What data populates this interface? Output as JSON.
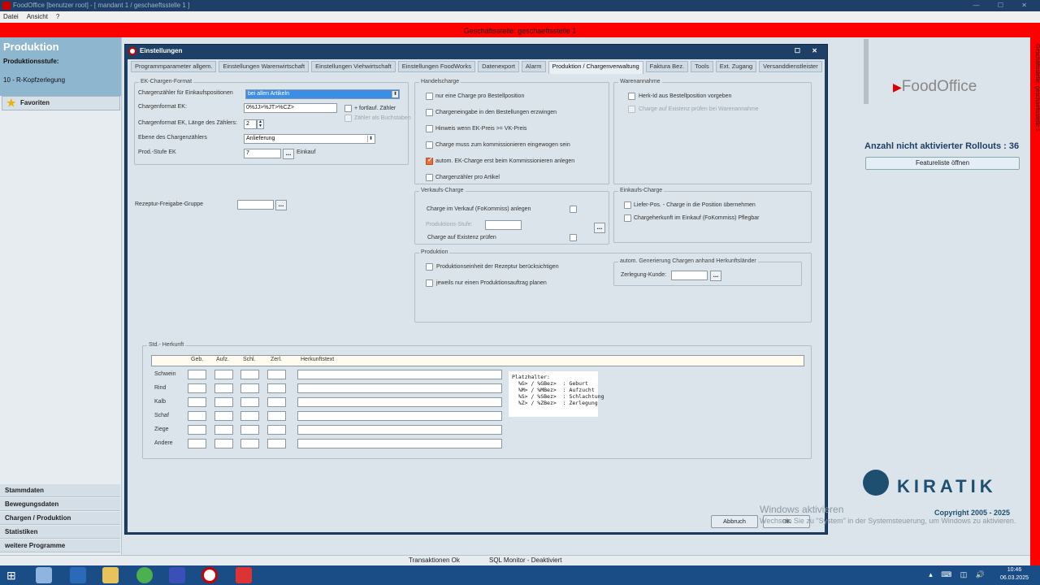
{
  "window": {
    "title": "FoodOffice [benutzer root] - [ mandant 1 / geschaeftsstelle 1 ]",
    "controls": "— ☐ ✕"
  },
  "menu": [
    "Datei",
    "Ansicht",
    "?"
  ],
  "header": {
    "geschaeftsstelle": "Geschäftsstelle: geschaeftsstelle 1",
    "side_label": "Geschäftsstelle: geschaeftsstelle 1"
  },
  "sidebar": {
    "title": "Produktion",
    "stufe_label": "Produktionsstufe:",
    "stufe_value": "10 - R-Kopfzerlegung",
    "favorites": "Favoriten",
    "bottom_items": [
      "Stammdaten",
      "Bewegungsdaten",
      "Chargen / Produktion",
      "Statistiken",
      "weitere Programme"
    ]
  },
  "dialog": {
    "title": "Einstellungen",
    "tabs": [
      "Programmparameter allgem.",
      "Einstellungen Warenwirtschaft",
      "Einstellungen Viehwirtschaft",
      "Einstellungen FoodWorks",
      "Datenexport",
      "Alarm",
      "Produktion / Chargenverwaltung",
      "Faktura Bez.",
      "Tools",
      "Ext. Zugang",
      "Versanddienstleister"
    ],
    "active_tab": "Produktion / Chargenverwaltung",
    "ek": {
      "title": "EK-Chargen-Format",
      "zaehler_label": "Chargenzähler für Einkaufspositionen",
      "zaehler_value": "bei allen Artikeln",
      "format_label": "Chargenformat EK:",
      "format_value": "0%JJ>%JT>%CZ>",
      "fortlauf": "+ fortlauf. Zähler",
      "buchstaben": "Zähler als Buchstaben",
      "laenge_label": "Chargenformat EK, Länge des Zählers:",
      "laenge_value": "2",
      "ebene_label": "Ebene des Chargenzählers",
      "ebene_value": "Anlieferung",
      "stufe_label": "Prod.-Stufe EK",
      "stufe_value": "7",
      "stufe_text": "Einkauf"
    },
    "rezeptur_label": "Rezeptur-Freigabe-Gruppe",
    "handel": {
      "title": "Handelscharge",
      "items": [
        {
          "label": "nur eine Charge pro Bestellposition",
          "checked": false
        },
        {
          "label": "Chargeneingabe in den Bestellungen erzwingen",
          "checked": false
        },
        {
          "label": "Hinweis wenn EK-Preis >= VK-Preis",
          "checked": false
        },
        {
          "label": "Charge muss zum kommissionieren eingewogen sein",
          "checked": false
        },
        {
          "label": "autom. EK-Charge erst beim Kommissionieren anlegen",
          "checked": true
        },
        {
          "label": "Chargenzähler pro Artikel",
          "checked": false
        }
      ]
    },
    "waren": {
      "title": "Warenannahme",
      "herk": "Herk-Id aus Bestellposition vorgeben",
      "existenz": "Charge auf Existenz prüfen bei Warenannahme"
    },
    "verkauf": {
      "title": "Verkaufs-Charge",
      "anlegen": "Charge im Verkauf (FoKommiss) anlegen",
      "stufe": "Produktions-Stufe:",
      "existenz": "Charge auf Existenz prüfen"
    },
    "einkauf": {
      "title": "Einkaufs-Charge",
      "liefer": "Liefer-Pos. - Charge in die Position übernehmen",
      "herkunft": "Chargeherkunft im Einkauf (FoKommiss) Pflegbar"
    },
    "produktion": {
      "title": "Produktion",
      "einheit": "Produktionseinheit der Rezeptur berücksichtigen",
      "auftrag": "jeweils nur einen Produktionsauftrag planen",
      "auto_title": "autom. Generierung Chargen anhand Herkunftsländer",
      "zerlegung": "Zerlegung-Kunde:"
    },
    "herkunft": {
      "title": "Std.- Herkunft",
      "columns": [
        "Geb.",
        "Aufz.",
        "Schl.",
        "Zerl.",
        "Herkunftstext"
      ],
      "rows": [
        "Schwein",
        "Rind",
        "Kalb",
        "Schaf",
        "Ziege",
        "Andere"
      ],
      "platzhalter": "Platzhalter:\n  %G> / %GBez>  : Geburt\n  %M> / %MBez>  : Aufzucht\n  %S> / %SBez>  : Schlachtung\n  %Z> / %ZBez>  : Zerlegung"
    },
    "dots": "...",
    "buttons": {
      "cancel": "Abbruch",
      "ok": "OK"
    }
  },
  "right": {
    "brand": "FoodOffice",
    "rollouts": "Anzahl nicht aktivierter Rollouts : 36",
    "feature_btn": "Featureliste öffnen",
    "kiratik": "KIRATIK",
    "copyright": "Copyright 2005 - 2025"
  },
  "watermark": {
    "line1": "Windows aktivieren",
    "line2": "Wechseln Sie zu \"System\" in der Systemsteuerung, um Windows zu aktivieren."
  },
  "status": {
    "transaktionen": "Transaktionen Ok",
    "sql": "SQL Monitor - Deaktiviert"
  },
  "taskbar": {
    "time": "10:46",
    "date": "06.03.2025"
  },
  "colors": {
    "accent_red": "#ff0000",
    "title_blue": "#1e3f66",
    "checked_orange": "#e8703a"
  }
}
